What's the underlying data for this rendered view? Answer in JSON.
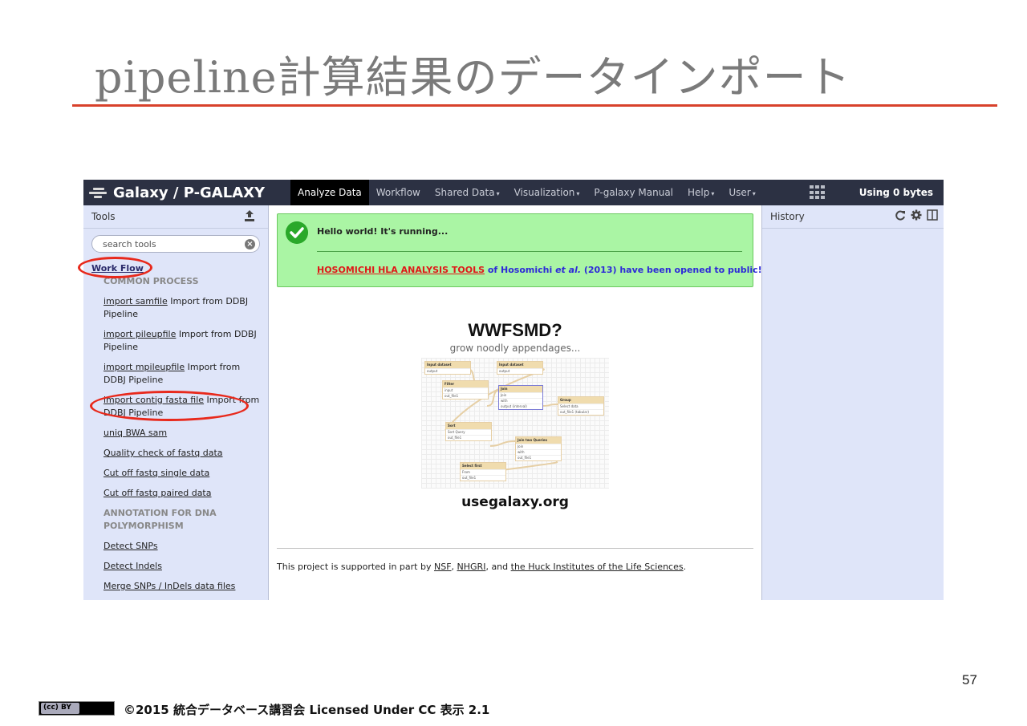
{
  "slide": {
    "title": "pipeline計算結果のデータインポート",
    "page_number": "57",
    "copyright": "©2015 統合データベース講習会 Licensed Under CC  表示 2.1",
    "cc_badge_text": "(cc) BY",
    "accent_color": "#d8412b"
  },
  "masthead": {
    "brand": "Galaxy / P-GALAXY",
    "nav": [
      {
        "label": "Analyze Data",
        "active": true
      },
      {
        "label": "Workflow"
      },
      {
        "label": "Shared Data",
        "caret": "▾"
      },
      {
        "label": "Visualization",
        "caret": "▾"
      },
      {
        "label": "P-galaxy Manual"
      },
      {
        "label": "Help",
        "caret": "▾"
      },
      {
        "label": "User",
        "caret": "▾"
      }
    ],
    "quota": "Using 0 bytes",
    "apps_icon": "grid-icon"
  },
  "tools": {
    "header": "Tools",
    "search_placeholder": "search tools",
    "section": "Work Flow",
    "items": [
      {
        "kind": "label",
        "text": "COMMON PROCESS"
      },
      {
        "kind": "tool",
        "link": "import samfile",
        "desc": " Import from DDBJ Pipeline"
      },
      {
        "kind": "tool",
        "link": "import pileupfile",
        "desc": " Import from DDBJ Pipeline"
      },
      {
        "kind": "tool",
        "link": "import mpileupfile",
        "desc": " Import from DDBJ Pipeline"
      },
      {
        "kind": "tool",
        "link": "import contig fasta file",
        "desc": " Import from DDBJ Pipeline"
      },
      {
        "kind": "tool",
        "link": "uniq BWA sam",
        "desc": ""
      },
      {
        "kind": "tool",
        "link": "Quality check of fastq data",
        "desc": ""
      },
      {
        "kind": "tool",
        "link": "Cut off fastq single data",
        "desc": ""
      },
      {
        "kind": "tool",
        "link": "Cut off fastq paired data",
        "desc": ""
      },
      {
        "kind": "label",
        "text": "ANNOTATION FOR DNA POLYMORPHISM"
      },
      {
        "kind": "tool",
        "link": "Detect SNPs",
        "desc": ""
      },
      {
        "kind": "tool",
        "link": "Detect Indels",
        "desc": ""
      },
      {
        "kind": "tool",
        "link": "Merge SNPs / InDels data files",
        "desc": ""
      }
    ]
  },
  "center": {
    "message_line1": "Hello world! It's running...",
    "message_link": "HOSOMICHI HLA ANALYSIS TOOLS",
    "message_mid": " of Hosomichi ",
    "message_etal": "et al.",
    "message_end": " (2013) have been opened to public!!",
    "splash_title": "WWFSMD?",
    "splash_subtitle": "grow noodly appendages...",
    "splash_url": "usegalaxy.org",
    "footer_prefix": "This project is supported in part by ",
    "footer_nsf": "NSF",
    "footer_sep1": ", ",
    "footer_nhgri": "NHGRI",
    "footer_sep2": ", and ",
    "footer_huck": "the Huck Institutes of the Life Sciences",
    "footer_end": "."
  },
  "workflow_nodes": [
    {
      "title": "Input dataset",
      "rows": [
        "output"
      ]
    },
    {
      "title": "Input dataset",
      "rows": [
        "output"
      ]
    },
    {
      "title": "Filter",
      "rows": [
        "input",
        "out_file1"
      ]
    },
    {
      "title": "Join",
      "rows": [
        "Join",
        "with",
        "output (interval)"
      ]
    },
    {
      "title": "Group",
      "rows": [
        "Select data",
        "out_file1 (tabular)"
      ]
    },
    {
      "title": "Sort",
      "rows": [
        "Sort Query",
        "out_file1"
      ]
    },
    {
      "title": "Join two Queries",
      "rows": [
        "Join",
        "with",
        "out_file1"
      ]
    },
    {
      "title": "Select first",
      "rows": [
        "From",
        "out_file1"
      ]
    }
  ],
  "history": {
    "header": "History",
    "icons": [
      "refresh-icon",
      "gear-icon",
      "columns-icon"
    ]
  }
}
